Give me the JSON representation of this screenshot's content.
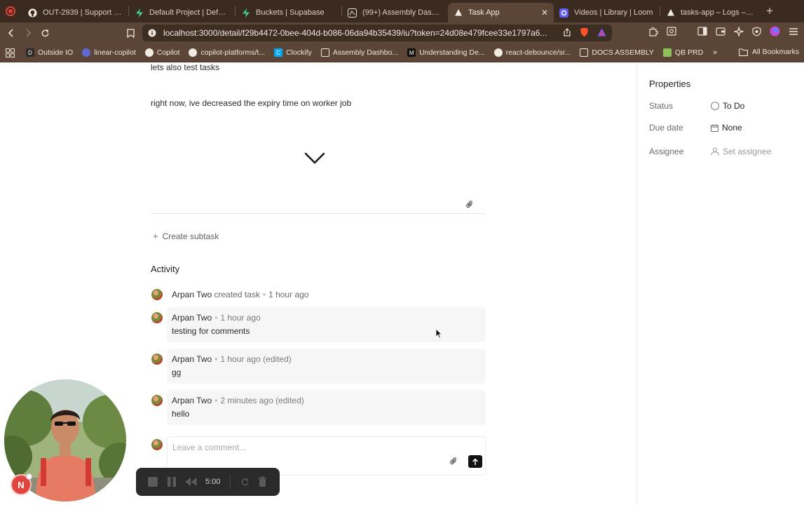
{
  "browser": {
    "tabs": [
      {
        "title": "OUT-2939 | Support com",
        "icon": "github-icon"
      },
      {
        "title": "Default Project | Default C",
        "icon": "supabase-icon"
      },
      {
        "title": "Buckets | Supabase",
        "icon": "supabase-icon"
      },
      {
        "title": "(99+) Assembly Dashboa",
        "icon": "assembly-icon"
      },
      {
        "title": "Task App",
        "icon": "triangle-icon",
        "active": true
      },
      {
        "title": "Videos | Library | Loom",
        "icon": "loom-icon"
      },
      {
        "title": "tasks-app – Logs – Verce",
        "icon": "vercel-icon"
      }
    ],
    "url": "localhost:3000/detail/f29b4472-0bee-404d-b086-06da94b35439/iu?token=24d08e479fcee33e1797a6...",
    "bookmarks": [
      {
        "label": "Outside IO",
        "icon": "outside-io-icon"
      },
      {
        "label": "linear-copilot",
        "icon": "linear-icon"
      },
      {
        "label": "Copilot",
        "icon": "github-icon"
      },
      {
        "label": "copilot-platforms/t...",
        "icon": "github-icon"
      },
      {
        "label": "Clockify",
        "icon": "clockify-icon"
      },
      {
        "label": "Assembly Dashbo...",
        "icon": "assembly-icon"
      },
      {
        "label": "Understanding De...",
        "icon": "medium-icon"
      },
      {
        "label": "react-debounce/sr...",
        "icon": "github-icon"
      },
      {
        "label": "DOCS ASSEMBLY",
        "icon": "assembly-icon"
      },
      {
        "label": "QB PRD",
        "icon": "qb-icon"
      }
    ],
    "all_bookmarks": "All Bookmarks"
  },
  "task": {
    "description_lines": [
      "lets also test tasks",
      "right now, ive decreased the expiry time on worker job"
    ],
    "create_subtask": "Create subtask"
  },
  "activity": {
    "title": "Activity",
    "log": {
      "user": "Arpan Two",
      "action": "created task",
      "time": "1 hour ago"
    },
    "comments": [
      {
        "user": "Arpan Two",
        "time": "1 hour ago",
        "body": "testing for comments"
      },
      {
        "user": "Arpan Two",
        "time": "1 hour ago (edited)",
        "body": "gg"
      },
      {
        "user": "Arpan Two",
        "time": "2 minutes ago (edited)",
        "body": "hello"
      }
    ],
    "comment_placeholder": "Leave a comment..."
  },
  "properties": {
    "title": "Properties",
    "status_label": "Status",
    "status_value": "To Do",
    "due_label": "Due date",
    "due_value": "None",
    "assignee_label": "Assignee",
    "assignee_value": "Set assignee"
  },
  "recorder": {
    "time": "5:00",
    "bubble_letter": "N"
  },
  "colors": {
    "chrome": "#5a4536",
    "tabbar": "#3a2a1f",
    "accent_record": "#e5413a"
  }
}
